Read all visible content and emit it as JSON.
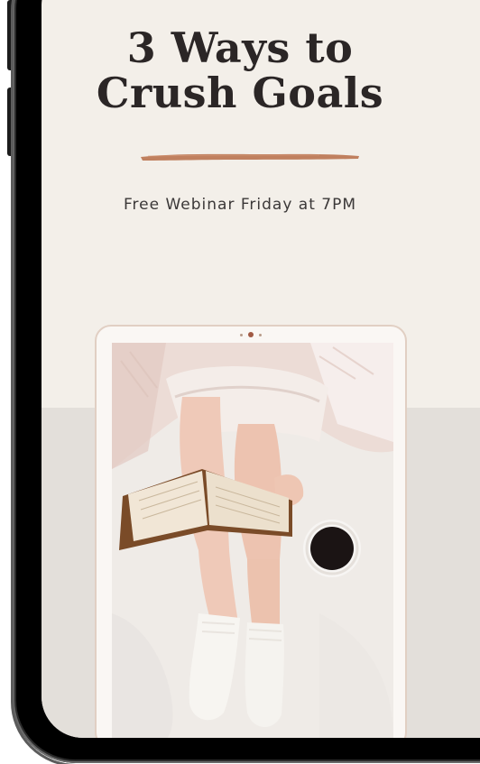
{
  "promo": {
    "title_line_1": "3 Ways to",
    "title_line_2": "Crush Goals",
    "subtitle": "Free Webinar Friday at 7PM"
  },
  "colors": {
    "screen_background": "#f3efe9",
    "lower_band": "#e3dfda",
    "brush_accent": "#c0805f",
    "title_text": "#2b2626",
    "tablet_border": "#e1cfc3",
    "phone_frame": "#000000"
  },
  "icons": {
    "tablet_camera": "camera-dots-icon",
    "brush_stroke": "brush-stroke-divider"
  }
}
